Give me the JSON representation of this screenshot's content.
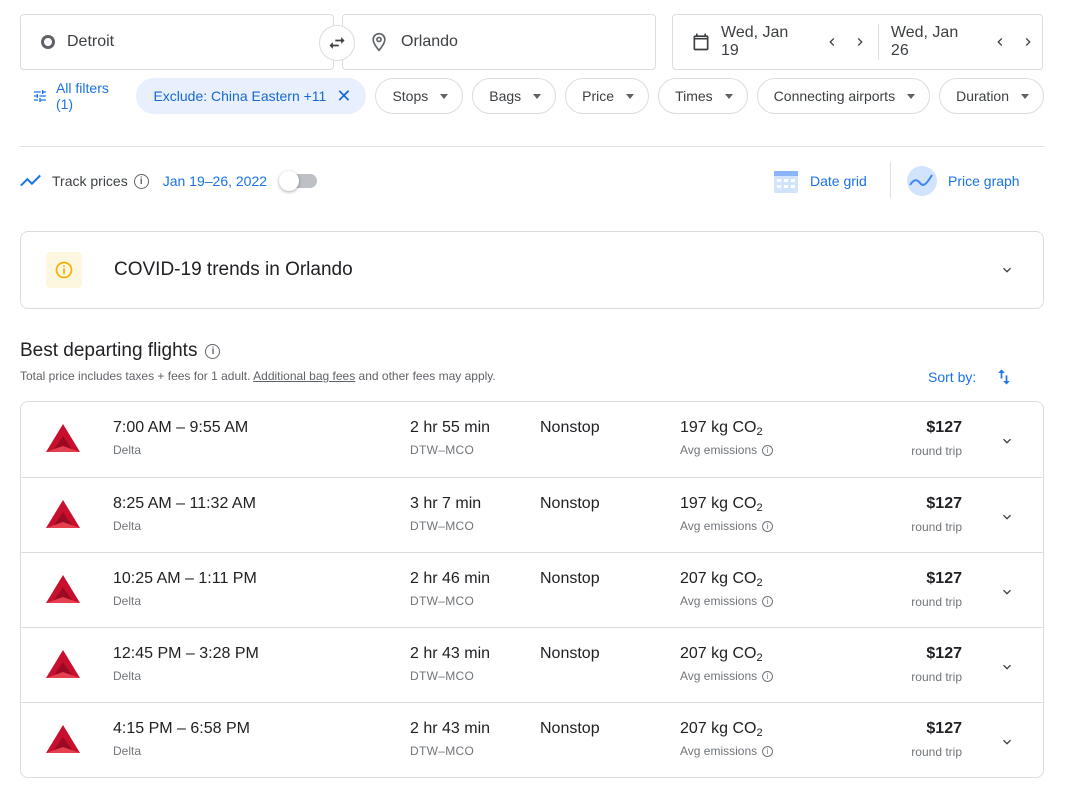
{
  "search": {
    "origin": "Detroit",
    "destination": "Orlando",
    "depart_date": "Wed, Jan 19",
    "return_date": "Wed, Jan 26"
  },
  "filters": {
    "all_filters_label": "All filters (1)",
    "active_chip_label": "Exclude: China Eastern +11",
    "chips": [
      "Stops",
      "Bags",
      "Price",
      "Times",
      "Connecting airports",
      "Duration"
    ]
  },
  "track": {
    "label": "Track prices",
    "range": "Jan 19–26, 2022"
  },
  "views": {
    "date_grid": "Date grid",
    "price_graph": "Price graph"
  },
  "covid": {
    "title": "COVID-19 trends in Orlando"
  },
  "section": {
    "title": "Best departing flights",
    "subtitle_before": "Total price includes taxes + fees for 1 adult. ",
    "subtitle_link": "Additional bag fees",
    "subtitle_after": " and other fees may apply.",
    "sort_label": "Sort by:"
  },
  "flights": [
    {
      "times": "7:00 AM – 9:55 AM",
      "airline": "Delta",
      "duration": "2 hr 55 min",
      "route": "DTW–MCO",
      "stops": "Nonstop",
      "co2": "197 kg CO",
      "co2_sub": "2",
      "emissions": "Avg emissions",
      "price": "$127",
      "trip": "round trip"
    },
    {
      "times": "8:25 AM – 11:32 AM",
      "airline": "Delta",
      "duration": "3 hr 7 min",
      "route": "DTW–MCO",
      "stops": "Nonstop",
      "co2": "197 kg CO",
      "co2_sub": "2",
      "emissions": "Avg emissions",
      "price": "$127",
      "trip": "round trip"
    },
    {
      "times": "10:25 AM – 1:11 PM",
      "airline": "Delta",
      "duration": "2 hr 46 min",
      "route": "DTW–MCO",
      "stops": "Nonstop",
      "co2": "207 kg CO",
      "co2_sub": "2",
      "emissions": "Avg emissions",
      "price": "$127",
      "trip": "round trip"
    },
    {
      "times": "12:45 PM – 3:28 PM",
      "airline": "Delta",
      "duration": "2 hr 43 min",
      "route": "DTW–MCO",
      "stops": "Nonstop",
      "co2": "207 kg CO",
      "co2_sub": "2",
      "emissions": "Avg emissions",
      "price": "$127",
      "trip": "round trip"
    },
    {
      "times": "4:15 PM – 6:58 PM",
      "airline": "Delta",
      "duration": "2 hr 43 min",
      "route": "DTW–MCO",
      "stops": "Nonstop",
      "co2": "207 kg CO",
      "co2_sub": "2",
      "emissions": "Avg emissions",
      "price": "$127",
      "trip": "round trip"
    }
  ],
  "colors": {
    "accent": "#1a73e8",
    "delta_red": "#c8102e",
    "chip_active_bg": "#e8f0fe"
  },
  "icons": {
    "origin": "circle-icon",
    "destination": "location-pin-icon",
    "swap": "swap-arrows-icon",
    "calendar": "calendar-icon",
    "track": "trending-line-icon",
    "covid": "warning-info-icon",
    "sort": "sort-arrows-icon",
    "expand": "chevron-down-icon",
    "airline": "delta-logo-icon"
  }
}
